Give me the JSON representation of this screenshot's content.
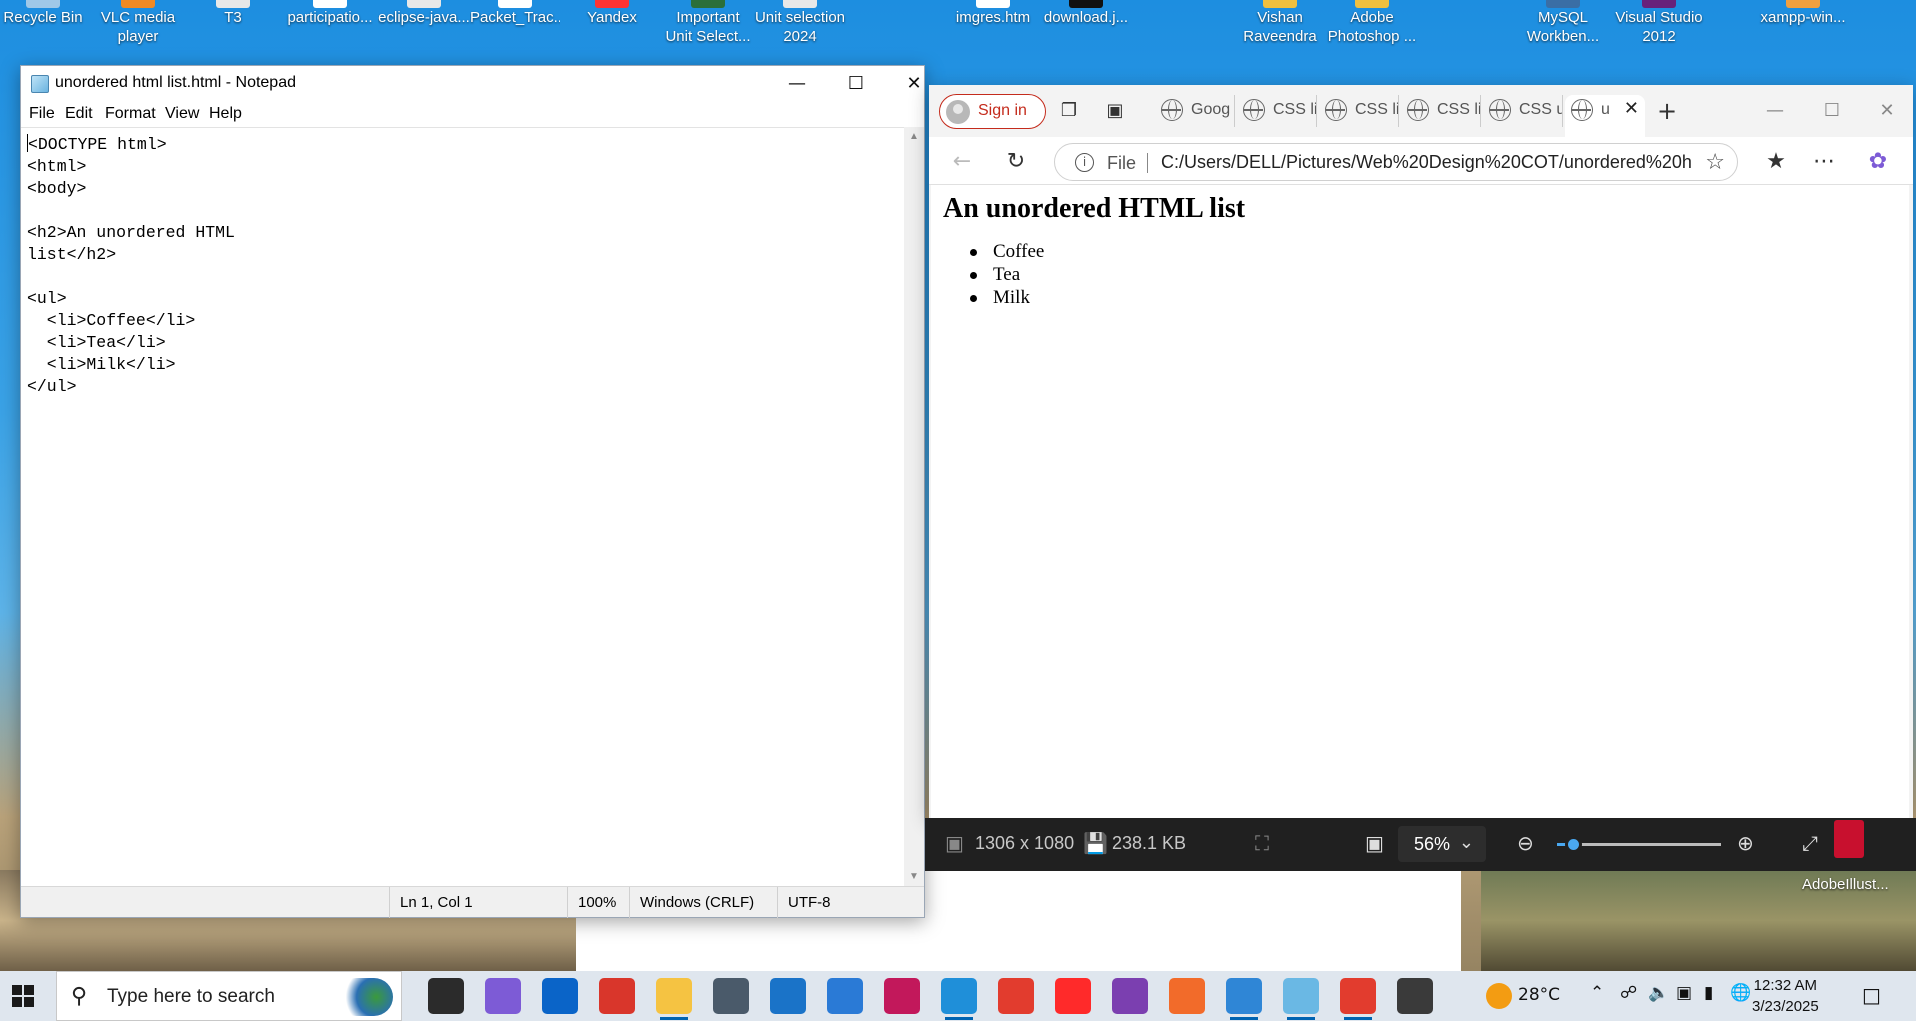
{
  "desktop": {
    "icons": [
      {
        "label": "Recycle Bin",
        "color": "#9fc8e8"
      },
      {
        "label": "VLC media player",
        "color": "#f08a24"
      },
      {
        "label": "T3",
        "color": "#e8e8e8"
      },
      {
        "label": "participatio...",
        "color": "#ffffff"
      },
      {
        "label": "eclipse-java...",
        "color": "#e8e8e8"
      },
      {
        "label": "Packet_Trac...",
        "color": "#ffffff"
      },
      {
        "label": "Yandex",
        "color": "#ff3333"
      },
      {
        "label": "Important Unit Select...",
        "color": "#2b6f3a"
      },
      {
        "label": "Unit selection 2024",
        "color": "#e8e8e8"
      },
      {
        "label": "imgres.htm",
        "color": "#ffffff"
      },
      {
        "label": "download.j...",
        "color": "#111111"
      },
      {
        "label": "Vishan Raveendra",
        "color": "#f0c040"
      },
      {
        "label": "Adobe Photoshop ...",
        "color": "#f0c040"
      },
      {
        "label": "MySQL Workben...",
        "color": "#3a6ea5"
      },
      {
        "label": "Visual Studio 2012",
        "color": "#68217a"
      },
      {
        "label": "xampp-win...",
        "color": "#f0a040"
      }
    ],
    "right_icon_label": "AdobeIllust..."
  },
  "notepad": {
    "title": "unordered html list.html - Notepad",
    "menu": [
      "File",
      "Edit",
      "Format",
      "View",
      "Help"
    ],
    "content": "<DOCTYPE html>\n<html>\n<body>\n\n<h2>An unordered HTML\nlist</h2>\n\n<ul>\n  <li>Coffee</li>\n  <li>Tea</li>\n  <li>Milk</li>\n</ul>",
    "status": {
      "position": "Ln 1, Col 1",
      "zoom": "100%",
      "line_ending": "Windows (CRLF)",
      "encoding": "UTF-8"
    }
  },
  "browser": {
    "signin_label": "Sign in",
    "tabs": [
      {
        "label": "Goog"
      },
      {
        "label": "CSS li"
      },
      {
        "label": "CSS li"
      },
      {
        "label": "CSS li"
      },
      {
        "label": "CSS u"
      },
      {
        "label": "u"
      }
    ],
    "new_tab_label": "+",
    "address": {
      "scheme_label": "File",
      "url": "C:/Users/DELL/Pictures/Web%20Design%20COT/unordered%20h..."
    },
    "page": {
      "heading": "An unordered HTML list",
      "items": [
        "Coffee",
        "Tea",
        "Milk"
      ]
    }
  },
  "viewer": {
    "dimensions": "1306 x 1080",
    "file_size": "238.1 KB",
    "zoom": "56%",
    "zoom_fraction": 0.1
  },
  "taskbar": {
    "search_placeholder": "Type here to search",
    "apps": [
      {
        "name": "task-view",
        "color": "#2b2b2b"
      },
      {
        "name": "copilot",
        "color": "#7d5bd6"
      },
      {
        "name": "outlook",
        "color": "#0a64c8"
      },
      {
        "name": "red-app",
        "color": "#d9362b"
      },
      {
        "name": "file-explorer",
        "color": "#f5c342"
      },
      {
        "name": "calculator",
        "color": "#4a5a6a"
      },
      {
        "name": "mail",
        "color": "#1a73c8"
      },
      {
        "name": "azure",
        "color": "#2a7ad6"
      },
      {
        "name": "snipping-tool",
        "color": "#c2185b"
      },
      {
        "name": "edge",
        "color": "#1f8fd9"
      },
      {
        "name": "chrome",
        "color": "#e23c2e"
      },
      {
        "name": "yandex-browser",
        "color": "#ff2a2a"
      },
      {
        "name": "mask-app",
        "color": "#7b3fb0"
      },
      {
        "name": "xampp",
        "color": "#f26b2a"
      },
      {
        "name": "photos",
        "color": "#2f86d6"
      },
      {
        "name": "notepad",
        "color": "#6ab8e4"
      },
      {
        "name": "chrome-2",
        "color": "#e23c2e"
      },
      {
        "name": "settings",
        "color": "#3a3a3a"
      }
    ],
    "weather_temp": "28°C",
    "time": "12:32 AM",
    "date": "3/23/2025"
  }
}
